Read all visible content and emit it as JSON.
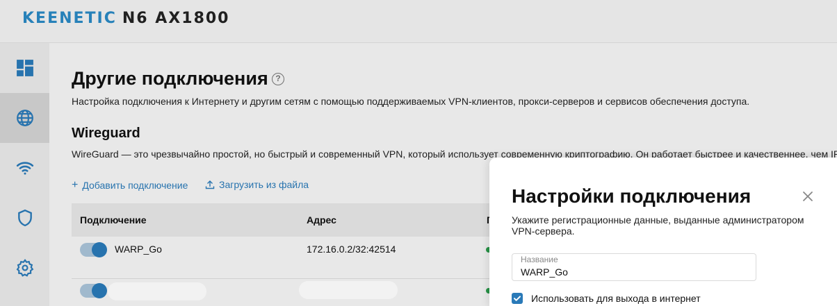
{
  "brand": {
    "name": "KEENETIC",
    "model": "N6 AX1800"
  },
  "sidebar": {
    "items": [
      {
        "name": "dashboard",
        "icon": "dashboard-icon"
      },
      {
        "name": "internet",
        "icon": "globe-icon",
        "active": true
      },
      {
        "name": "wifi",
        "icon": "wifi-icon"
      },
      {
        "name": "security",
        "icon": "shield-icon"
      },
      {
        "name": "settings",
        "icon": "gear-icon"
      }
    ]
  },
  "page": {
    "title": "Другие подключения",
    "help": "?",
    "description": "Настройка подключения к Интернету и другим сетям с помощью поддерживаемых VPN-клиентов, прокси-серверов и сервисов обеспечения доступа."
  },
  "wireguard": {
    "title": "Wireguard",
    "description": "WireGuard — это чрезвычайно простой, но быстрый и современный VPN, который использует современную криптографию. Он работает быстрее и качественнее, чем IPsec",
    "add_label": "Добавить подключение",
    "upload_label": "Загрузить из файла"
  },
  "table": {
    "columns": [
      "Подключение",
      "Адрес",
      "П"
    ],
    "rows": [
      {
        "name": "WARP_Go",
        "address": "172.16.0.2/32:42514",
        "enabled": true,
        "status": "green"
      },
      {
        "name": "",
        "address": "",
        "enabled": true,
        "status": "green",
        "redacted": true
      }
    ]
  },
  "modal": {
    "title": "Настройки подключения",
    "description": "Укажите регистрационные данные, выданные администратором VPN-сервера.",
    "name_label": "Название",
    "name_value": "WARP_Go",
    "checkbox_label": "Использовать для выхода в интернет",
    "checkbox_checked": true
  },
  "colors": {
    "accent": "#2a7ab8",
    "brand": "#2a88c3",
    "status_ok": "#2a9a4a"
  }
}
